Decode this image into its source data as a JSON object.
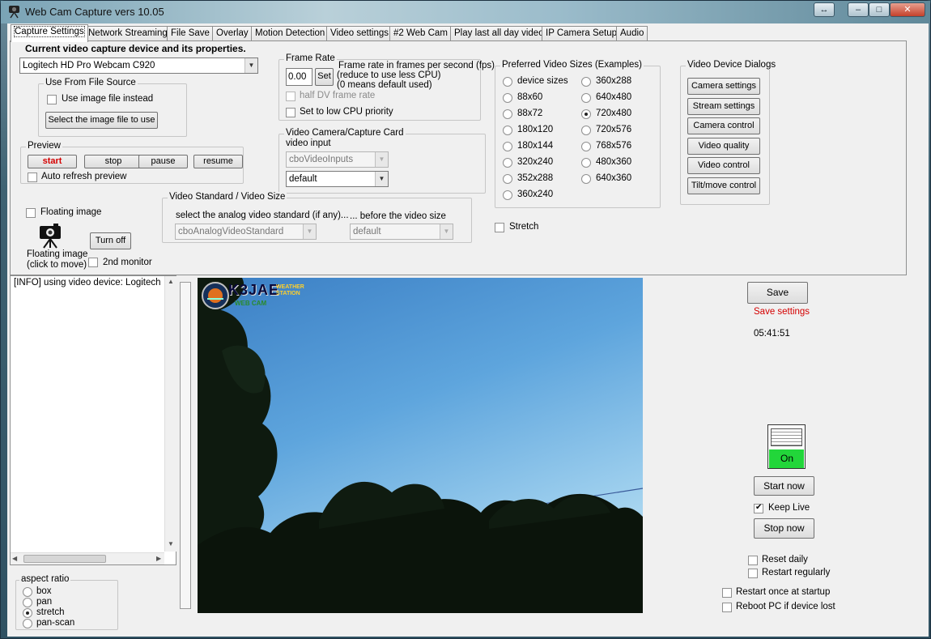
{
  "window": {
    "title": "Web Cam Capture vers 10.05"
  },
  "tabs": [
    {
      "label": "Capture Settings",
      "active": true
    },
    {
      "label": "Network Streaming"
    },
    {
      "label": "File Save"
    },
    {
      "label": "Overlay"
    },
    {
      "label": "Motion Detection"
    },
    {
      "label": "Video settings"
    },
    {
      "label": "#2 Web Cam"
    },
    {
      "label": "Play last all day video"
    },
    {
      "label": "IP Camera Setup"
    },
    {
      "label": "Audio"
    }
  ],
  "capture": {
    "heading": "Current video capture device and its properties.",
    "device_selected": "Logitech HD Pro Webcam C920",
    "file_source": {
      "legend": "Use From File Source",
      "use_image_label": "Use image file instead",
      "select_button": "Select the image file to use"
    },
    "preview": {
      "legend": "Preview",
      "start": "start",
      "stop": "stop",
      "pause": "pause",
      "resume": "resume",
      "auto_refresh": "Auto refresh preview"
    },
    "floating": {
      "checkbox_label": "Floating image",
      "icon_caption_1": "Floating image",
      "icon_caption_2": "(click to move)",
      "turn_off": "Turn off",
      "second_monitor": "2nd monitor"
    }
  },
  "frame_rate": {
    "legend": "Frame Rate",
    "value": "0.00",
    "set_button": "Set",
    "desc_1": "Frame rate in frames per second (fps)",
    "desc_2": "(reduce to use less CPU)",
    "desc_3": "(0 means default used)",
    "half_dv": "half DV frame rate",
    "low_cpu": "Set to low CPU priority"
  },
  "video_card": {
    "legend": "Video Camera/Capture Card",
    "input_label": "video input",
    "inputs_combo": "cboVideoInputs",
    "default_combo": "default"
  },
  "video_standard": {
    "legend": "Video Standard / Video Size",
    "select_label": "select the analog video standard (if any)...",
    "before_label": "... before the video size",
    "standard_combo": "cboAnalogVideoStandard",
    "size_combo": "default"
  },
  "sizes": {
    "legend": "Preferred Video Sizes (Examples)",
    "col1": [
      "device sizes",
      "88x60",
      "88x72",
      "180x120",
      "180x144",
      "320x240",
      "352x288",
      "360x240"
    ],
    "col2": [
      "360x288",
      "640x480",
      "720x480",
      "720x576",
      "768x576",
      "480x360",
      "640x360"
    ],
    "selected": "720x480",
    "stretch": "Stretch"
  },
  "dialogs": {
    "legend": "Video Device Dialogs",
    "buttons": [
      "Camera settings",
      "Stream settings",
      "Camera control",
      "Video quality",
      "Video control",
      "Tilt/move control"
    ]
  },
  "log": {
    "line": "[INFO] using video device: Logitech HD"
  },
  "aspect": {
    "legend": "aspect ratio",
    "options": [
      "box",
      "pan",
      "stretch",
      "pan-scan"
    ],
    "selected": "stretch"
  },
  "overlay": {
    "callsign": "K3JAE",
    "tag": "WEATHER STATION",
    "sub": "WEB CAM"
  },
  "right": {
    "save_button": "Save",
    "save_status": "Save settings",
    "time": "05:41:51",
    "switch_label": "On",
    "start_now": "Start now",
    "keep_live": "Keep Live",
    "stop_now": "Stop now",
    "reset_daily": "Reset daily",
    "restart_regularly": "Restart regularly",
    "restart_startup": "Restart once at startup",
    "reboot": "Reboot PC if device lost"
  },
  "colors": {
    "accent_red": "#d40000",
    "switch_green": "#22d63a"
  }
}
